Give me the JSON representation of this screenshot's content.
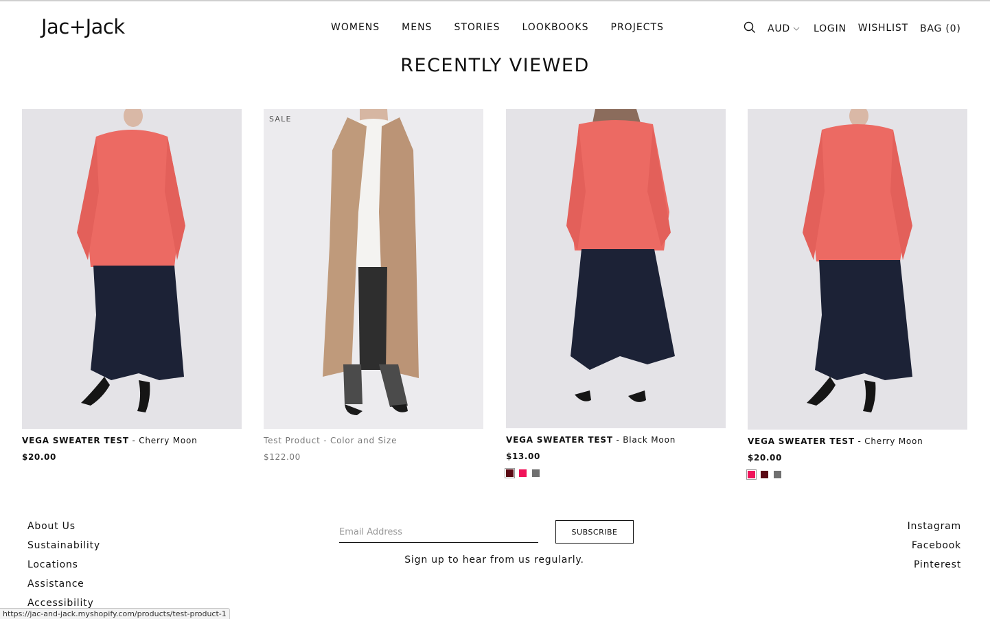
{
  "header": {
    "logo": "Jac+Jack",
    "nav": [
      "WOMENS",
      "MENS",
      "STORIES",
      "LOOKBOOKS",
      "PROJECTS"
    ],
    "currency": "AUD",
    "login": "LOGIN",
    "wishlist": "WISHLIST",
    "bag": "BAG (0)"
  },
  "section_title": "RECENTLY VIEWED",
  "products": [
    {
      "name": "VEGA SWEATER TEST",
      "variant": " - Cherry Moon",
      "price": "$20.00"
    },
    {
      "badge": "SALE",
      "name": "Test Product",
      "variant": " - Color and Size",
      "price": "$122.00"
    },
    {
      "name": "VEGA SWEATER TEST",
      "variant": " - Black Moon",
      "price": "$13.00"
    },
    {
      "name": "VEGA SWEATER TEST",
      "variant": " - Cherry Moon",
      "price": "$20.00"
    }
  ],
  "swatch_colors": {
    "burgundy": "#5a0a14",
    "pink": "#f0145a",
    "grey": "#707070"
  },
  "footer": {
    "links": [
      "About Us",
      "Sustainability",
      "Locations",
      "Assistance",
      "Accessibility"
    ],
    "email_placeholder": "Email Address",
    "subscribe": "SUBSCRIBE",
    "signup_text": "Sign up to hear from us regularly.",
    "social": [
      "Instagram",
      "Facebook",
      "Pinterest"
    ]
  },
  "status_url": "https://jac-and-jack.myshopify.com/products/test-product-1"
}
